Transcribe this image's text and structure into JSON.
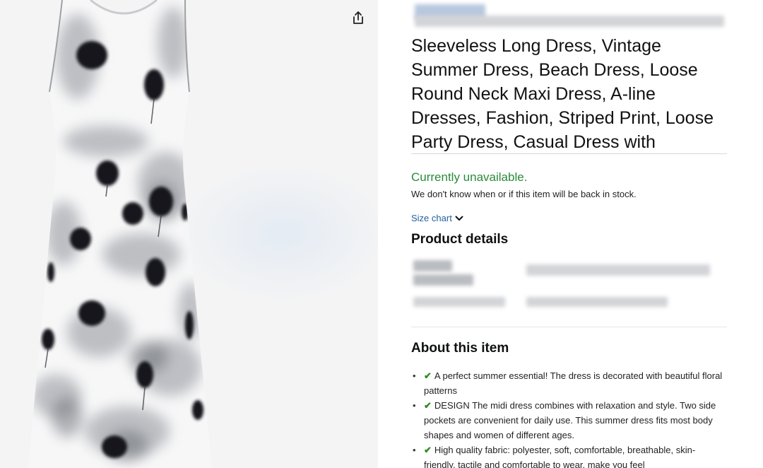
{
  "product": {
    "title": "Sleeveless Long Dress, Vintage Summer Dress, Beach Dress, Loose Round Neck Maxi Dress, A-line Dresses, Fashion, Striped Print, Loose Party Dress, Casual Dress with",
    "availability": "Currently unavailable.",
    "stock_note": "We don't know when or if this item will be back in stock.",
    "size_chart_label": "Size chart",
    "product_details_heading": "Product details",
    "about_heading": "About this item",
    "bullets": [
      "A perfect summer essential! The dress is decorated with beautiful floral patterns",
      "DESIGN The midi dress combines with relaxation and style. Two side pockets are convenient for daily use. This summer dress fits most body shapes and women of different ages.",
      "High quality fabric: polyester, soft, comfortable, breathable, skin-friendly, tactile and comfortable to wear, make you feel"
    ]
  },
  "icons": {
    "share": "share-icon",
    "chevron": "chevron-down-icon",
    "check": "checkmark-icon"
  },
  "colors": {
    "availability_green": "#2a8a3a",
    "link_blue": "#2162a1",
    "check_green": "#2e8b22"
  }
}
